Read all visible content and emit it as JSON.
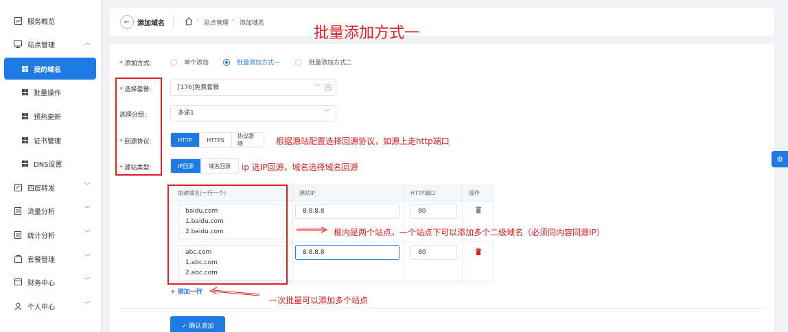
{
  "sidebar": {
    "items": [
      {
        "label": "服务概览",
        "icon": "chart-icon"
      },
      {
        "label": "站点管理",
        "icon": "site-icon"
      },
      {
        "label": "四层转发",
        "icon": "forward-icon"
      },
      {
        "label": "流量分析",
        "icon": "doc-icon"
      },
      {
        "label": "统计分析",
        "icon": "doc-icon"
      },
      {
        "label": "套餐管理",
        "icon": "package-icon"
      },
      {
        "label": "财务中心",
        "icon": "wallet-icon"
      },
      {
        "label": "个人中心",
        "icon": "user-icon"
      }
    ],
    "sub_items": [
      {
        "label": "我的域名",
        "active": true
      },
      {
        "label": "批量操作"
      },
      {
        "label": "预热更新"
      },
      {
        "label": "证书管理"
      },
      {
        "label": "DNS设置"
      }
    ]
  },
  "header": {
    "title": "添加域名",
    "breadcrumb": [
      "站点管理",
      "添加域名"
    ]
  },
  "overlay_title": "批量添加方式一",
  "form": {
    "add_mode_label": "添加方式:",
    "add_modes": [
      "单个添加",
      "批量添加方式一",
      "批量添加方式二"
    ],
    "package_label": "选择套餐:",
    "package_value": "[176]免费套餐",
    "group_label": "选择分组:",
    "group_value": "多途1",
    "protocol_label": "回源协议:",
    "protocols": [
      "HTTP",
      "HTTPS",
      "协议跟随"
    ],
    "origin_type_label": "源站类型:",
    "origin_types": [
      "IP回源",
      "域名回源"
    ]
  },
  "table": {
    "headers": [
      "加速域名(一行一个)",
      "源站IP",
      "HTTP端口",
      "操作"
    ],
    "rows": [
      {
        "domains": [
          "baidu.com",
          "1.baidu.com",
          "2.baidu.com"
        ],
        "ip": "8.8.8.8",
        "port": "80"
      },
      {
        "domains": [
          "abc.com",
          "1.abc.com",
          "2.abc.com"
        ],
        "ip": "8.8.8.8",
        "port": "80"
      }
    ]
  },
  "add_row_label": "+ 添加一行",
  "confirm_label": "✓ 确认添加",
  "annotations": {
    "protocol_note": "根据源站配置选择回源协议，如源上走http端口",
    "origin_note": "ip 选IP回源，域名选择域名回源",
    "box_note": "框内是两个站点，一个站点下可以添加多个二级域名（必须同内容同源IP）",
    "batch_note": "一次批量可以添加多个站点"
  },
  "colors": {
    "accent": "#1e7be5",
    "annotation": "#e02020",
    "delete": "#e02020"
  }
}
